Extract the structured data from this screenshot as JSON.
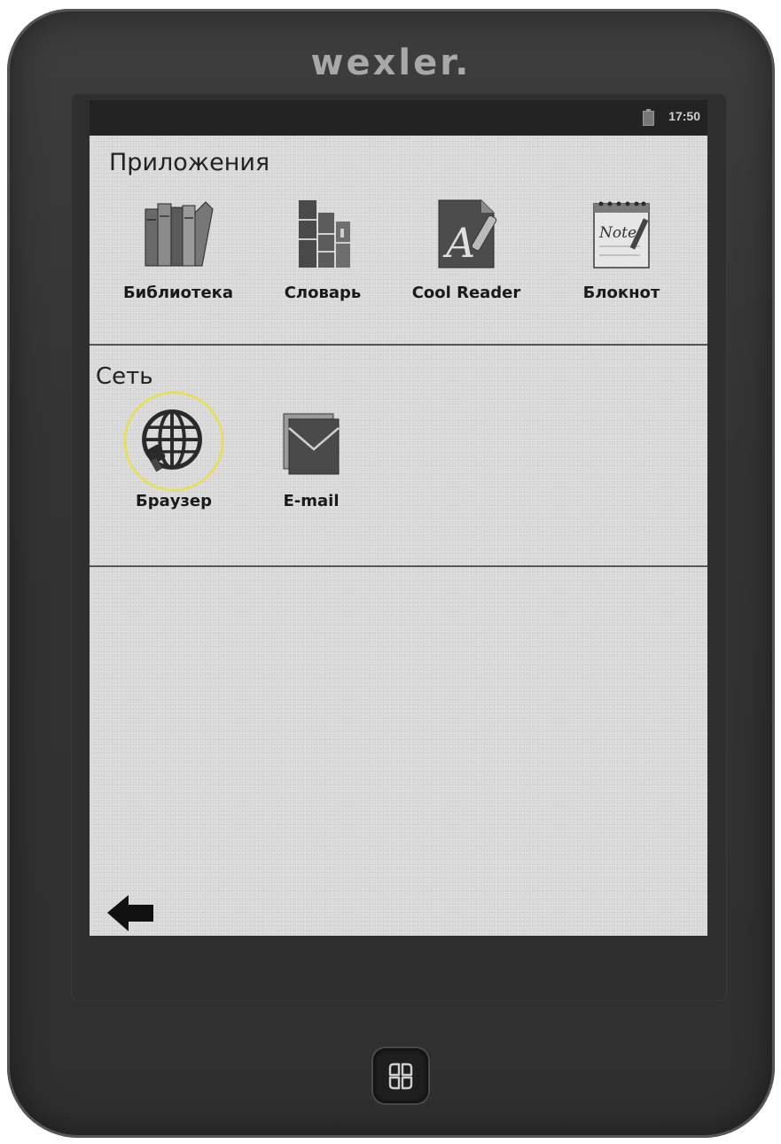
{
  "device": {
    "brand": "wexler."
  },
  "status_bar": {
    "time": "17:50",
    "icons": [
      "battery-icon"
    ]
  },
  "sections": [
    {
      "title": "Приложения",
      "apps": [
        {
          "label": "Библиотека",
          "icon": "library-books-icon"
        },
        {
          "label": "Словарь",
          "icon": "dictionary-icon"
        },
        {
          "label": "Cool Reader",
          "icon": "cool-reader-icon"
        },
        {
          "label": "Блокнот",
          "icon": "notepad-icon"
        }
      ]
    },
    {
      "title": "Сеть",
      "apps": [
        {
          "label": "Браузер",
          "icon": "browser-globe-icon",
          "highlighted": true
        },
        {
          "label": "E-mail",
          "icon": "email-envelope-icon"
        }
      ]
    }
  ],
  "navigation": {
    "back_icon": "back-arrow-icon",
    "home_icon": "home-grid-icon"
  },
  "colors": {
    "highlight_ring": "#e8e04a",
    "screen_background": "#dcdcdc",
    "bezel": "#333333"
  }
}
